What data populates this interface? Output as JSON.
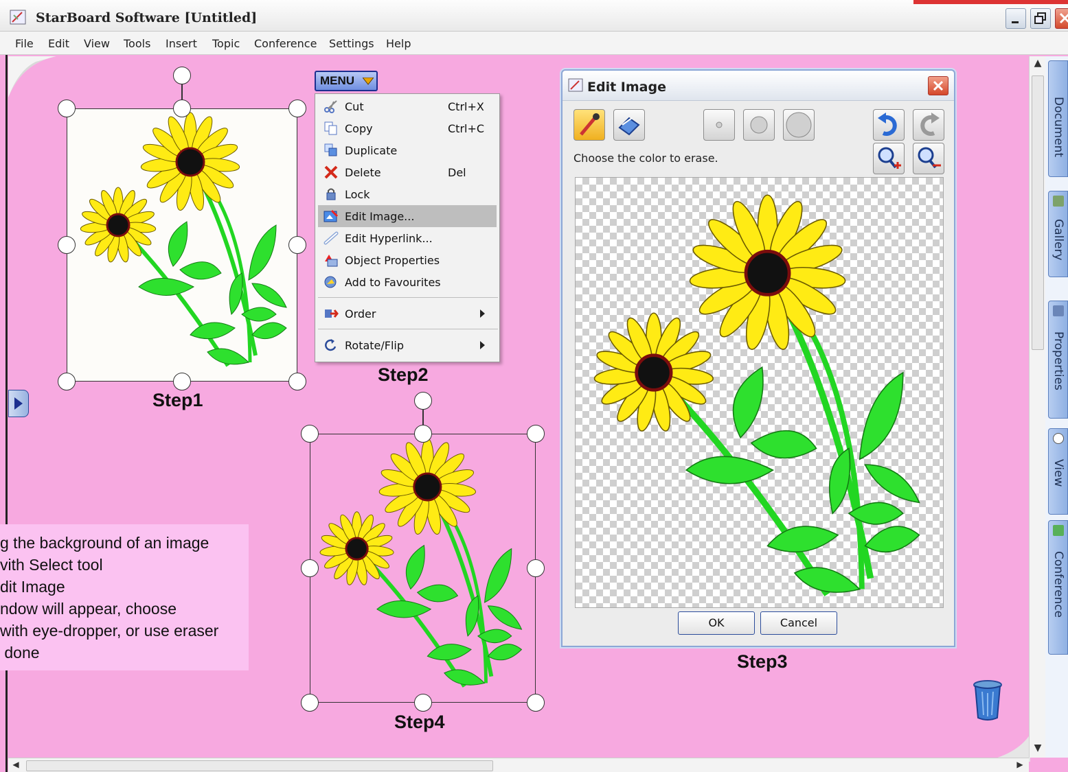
{
  "app": {
    "title": "StarBoard Software [Untitled]"
  },
  "menubar": {
    "items": [
      "File",
      "Edit",
      "View",
      "Tools",
      "Insert",
      "Topic",
      "Conference",
      "Settings",
      "Help"
    ]
  },
  "context_menu": {
    "button_label": "MENU",
    "items": [
      {
        "label": "Cut",
        "shortcut": "Ctrl+X",
        "icon": "scissors-icon"
      },
      {
        "label": "Copy",
        "shortcut": "Ctrl+C",
        "icon": "copy-icon"
      },
      {
        "label": "Duplicate",
        "shortcut": "",
        "icon": "duplicate-icon"
      },
      {
        "label": "Delete",
        "shortcut": "Del",
        "icon": "delete-x-icon"
      },
      {
        "label": "Lock",
        "shortcut": "",
        "icon": "lock-icon"
      },
      {
        "label": "Edit Image...",
        "shortcut": "",
        "icon": "edit-image-icon",
        "highlighted": true
      },
      {
        "label": "Edit Hyperlink...",
        "shortcut": "",
        "icon": "hyperlink-icon"
      },
      {
        "label": "Object Properties",
        "shortcut": "",
        "icon": "properties-icon"
      },
      {
        "label": "Add to Favourites",
        "shortcut": "",
        "icon": "favourites-icon"
      },
      {
        "label": "Order",
        "shortcut": "",
        "icon": "order-icon",
        "submenu": true
      },
      {
        "label": "Rotate/Flip",
        "shortcut": "",
        "icon": "rotate-icon",
        "submenu": true
      }
    ]
  },
  "dialog": {
    "title": "Edit Image",
    "instruction": "Choose the color to erase.",
    "ok_label": "OK",
    "cancel_label": "Cancel",
    "tools": [
      "eyedropper-icon",
      "eraser-icon",
      "small-brush-icon",
      "medium-brush-icon",
      "large-brush-icon",
      "undo-icon",
      "redo-icon",
      "zoom-in-icon",
      "zoom-out-icon"
    ]
  },
  "steps": {
    "step1": "Step1",
    "step2": "Step2",
    "step3": "Step3",
    "step4": "Step4"
  },
  "note": {
    "lines": [
      "g the background of an image",
      "vith Select tool",
      "dit Image",
      "ndow will appear, choose",
      "with eye-dropper, or use eraser",
      " done"
    ]
  },
  "side_panel": {
    "tabs": [
      "Document",
      "Gallery",
      "Properties",
      "View",
      "Conference"
    ]
  },
  "colors": {
    "canvas_background": "#f7a9e0",
    "note_background": "#fbc2f1",
    "menu_highlight": "#bebebe",
    "accent": "#2a4b9a"
  }
}
